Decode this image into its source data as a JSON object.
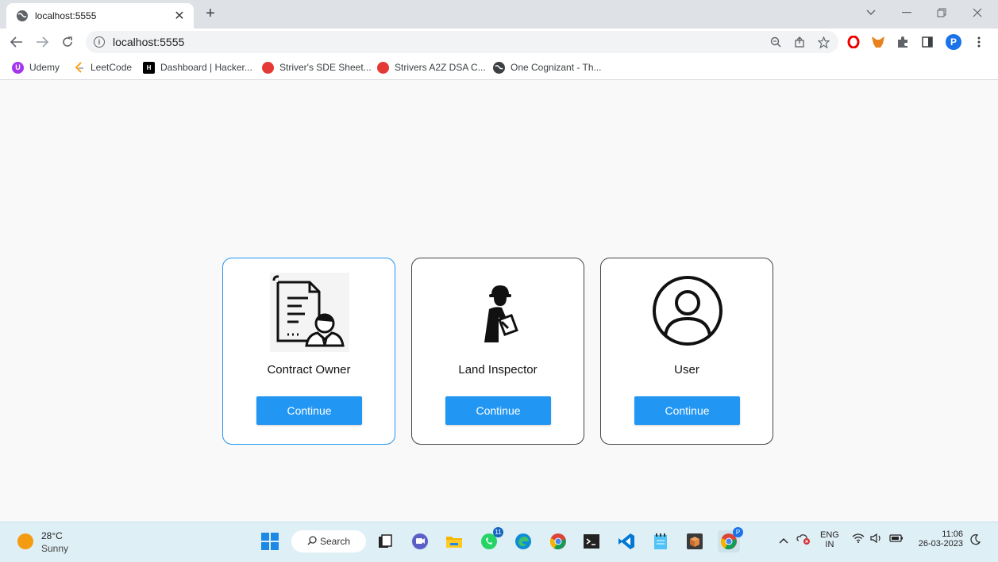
{
  "browser": {
    "tab_title": "localhost:5555",
    "tab_close": "✕",
    "new_tab": "+",
    "url": "localhost:5555",
    "profile_initial": "P"
  },
  "bookmarks": [
    {
      "label": "Udemy",
      "color": "#a435f0",
      "icon": "U"
    },
    {
      "label": "LeetCode",
      "color": "#ffa116",
      "icon": ""
    },
    {
      "label": "Dashboard | Hacker...",
      "color": "#000000",
      "icon": "H"
    },
    {
      "label": "Striver's SDE Sheet...",
      "color": "#e53935",
      "icon": ""
    },
    {
      "label": "Strivers A2Z DSA C...",
      "color": "#e53935",
      "icon": ""
    },
    {
      "label": "One Cognizant - Th...",
      "color": "#3c4043",
      "icon": ""
    }
  ],
  "cards": [
    {
      "label": "Contract Owner",
      "button": "Continue",
      "icon": "contract-owner-icon",
      "active": true
    },
    {
      "label": "Land Inspector",
      "button": "Continue",
      "icon": "land-inspector-icon",
      "active": false
    },
    {
      "label": "User",
      "button": "Continue",
      "icon": "user-icon",
      "active": false
    }
  ],
  "taskbar": {
    "temperature": "28°C",
    "weather": "Sunny",
    "search_label": "Search",
    "whatsapp_badge": "11",
    "chrome_badge": "P",
    "language_line1": "ENG",
    "language_line2": "IN",
    "time": "11:06",
    "date": "26-03-2023"
  }
}
